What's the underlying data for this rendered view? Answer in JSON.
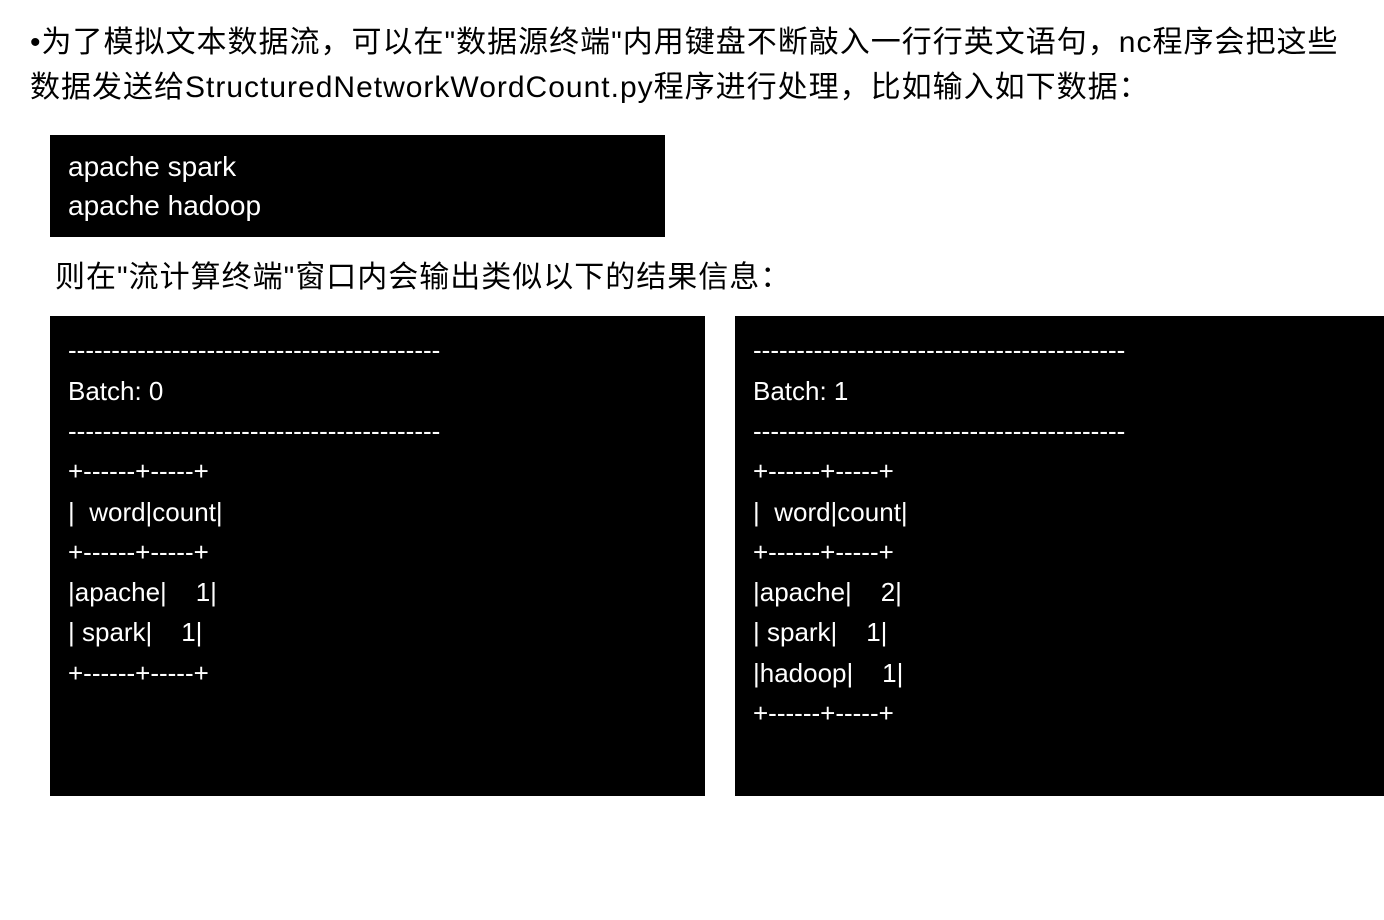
{
  "intro": "•为了模拟文本数据流，可以在\"数据源终端\"内用键盘不断敲入一行行英文语句，nc程序会把这些数据发送给StructuredNetworkWordCount.py程序进行处理，比如输入如下数据：",
  "input_terminal": {
    "line1": "apache spark",
    "line2": "apache hadoop"
  },
  "middle": "则在\"流计算终端\"窗口内会输出类似以下的结果信息：",
  "output_left": "-------------------------------------------\nBatch: 0\n-------------------------------------------\n+------+-----+\n|  word|count|\n+------+-----+\n|apache|    1|\n| spark|    1|\n+------+-----+",
  "output_right": "-------------------------------------------\nBatch: 1\n-------------------------------------------\n+------+-----+\n|  word|count|\n+------+-----+\n|apache|    2|\n| spark|    1|\n|hadoop|    1|\n+------+-----+",
  "chart_data": {
    "type": "table",
    "batches": [
      {
        "batch_number": 0,
        "columns": [
          "word",
          "count"
        ],
        "rows": [
          {
            "word": "apache",
            "count": 1
          },
          {
            "word": "spark",
            "count": 1
          }
        ]
      },
      {
        "batch_number": 1,
        "columns": [
          "word",
          "count"
        ],
        "rows": [
          {
            "word": "apache",
            "count": 2
          },
          {
            "word": "spark",
            "count": 1
          },
          {
            "word": "hadoop",
            "count": 1
          }
        ]
      }
    ],
    "input_data": [
      "apache spark",
      "apache hadoop"
    ]
  }
}
